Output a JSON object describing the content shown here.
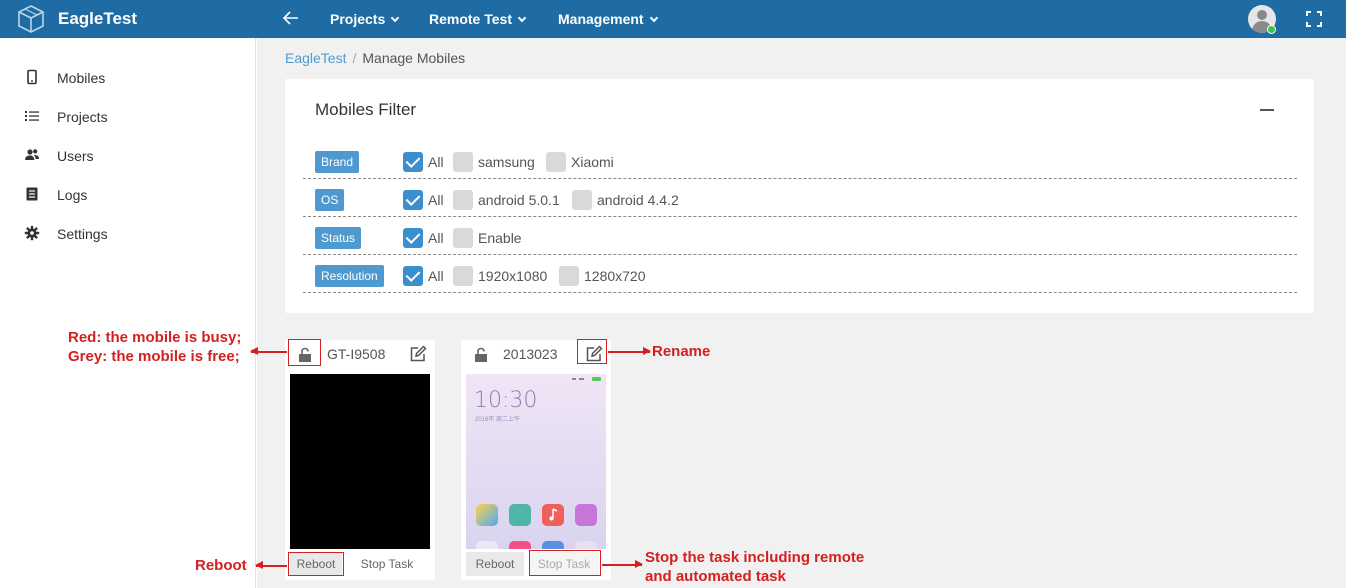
{
  "app": {
    "brand": "EagleTest",
    "logo_icon": "cube-logo-icon"
  },
  "topnav": {
    "back_icon": "arrow-left-icon",
    "items": [
      {
        "label": "Projects"
      },
      {
        "label": "Remote Test"
      },
      {
        "label": "Management"
      }
    ],
    "user_status": "online",
    "fullscreen_icon": "fullscreen-icon"
  },
  "sidebar": {
    "items": [
      {
        "label": "Mobiles",
        "icon": "mobile-icon"
      },
      {
        "label": "Projects",
        "icon": "list-icon"
      },
      {
        "label": "Users",
        "icon": "users-icon"
      },
      {
        "label": "Logs",
        "icon": "document-icon"
      },
      {
        "label": "Settings",
        "icon": "gear-icon"
      }
    ]
  },
  "breadcrumb": {
    "root": "EagleTest",
    "separator": "/",
    "current": "Manage Mobiles"
  },
  "filter": {
    "title": "Mobiles Filter",
    "rows": [
      {
        "label": "Brand",
        "options": [
          {
            "text": "All",
            "checked": true
          },
          {
            "text": "samsung",
            "checked": false
          },
          {
            "text": "Xiaomi",
            "checked": false
          }
        ]
      },
      {
        "label": "OS",
        "options": [
          {
            "text": "All",
            "checked": true
          },
          {
            "text": "android 5.0.1",
            "checked": false
          },
          {
            "text": "android 4.4.2",
            "checked": false
          }
        ]
      },
      {
        "label": "Status",
        "options": [
          {
            "text": "All",
            "checked": true
          },
          {
            "text": "Enable",
            "checked": false
          }
        ]
      },
      {
        "label": "Resolution",
        "options": [
          {
            "text": "All",
            "checked": true
          },
          {
            "text": "1920x1080",
            "checked": false
          },
          {
            "text": "1280x720",
            "checked": false
          }
        ]
      }
    ]
  },
  "devices": [
    {
      "name": "GT-I9508",
      "lock_status": "free",
      "reboot_label": "Reboot",
      "stop_label": "Stop Task",
      "screen": "off"
    },
    {
      "name": "2013023",
      "lock_status": "free",
      "reboot_label": "Reboot",
      "stop_label": "Stop Task",
      "screen": "home",
      "home": {
        "time": "10:30",
        "date": "2016年 周二上午"
      }
    }
  ],
  "annotations": {
    "lock_line1": "Red: the mobile is busy;",
    "lock_line2": "Grey: the mobile is free;",
    "rename": "Rename",
    "reboot": "Reboot",
    "stop_line1": "Stop the task including remote",
    "stop_line2": "and automated task"
  },
  "colors": {
    "topbar": "#1e6ca3",
    "accent": "#4e9ad0",
    "annotation": "#d42020",
    "checkbox_on": "#3a8fd0"
  }
}
